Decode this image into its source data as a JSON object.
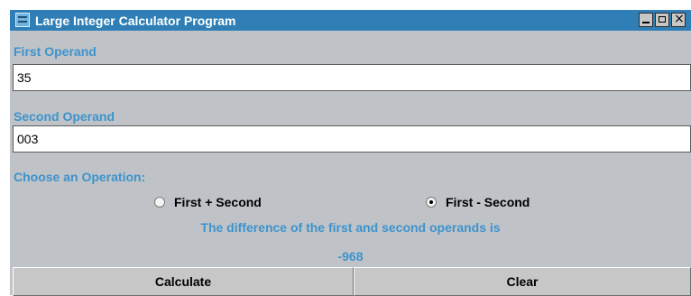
{
  "window": {
    "title": "Large Integer Calculator Program"
  },
  "labels": {
    "first_operand": "First Operand",
    "second_operand": "Second Operand",
    "choose_operation": "Choose an Operation:"
  },
  "inputs": {
    "first_value": "35",
    "second_value": "003"
  },
  "operations": [
    {
      "label": "First + Second",
      "selected": false
    },
    {
      "label": "First - Second",
      "selected": true
    }
  ],
  "result": {
    "message": "The difference of the first and second operands is",
    "value": "-968"
  },
  "buttons": {
    "calculate": "Calculate",
    "clear": "Clear"
  },
  "icons": {
    "app": "app-icon",
    "minimize": "minimize-icon",
    "maximize": "maximize-icon",
    "close": "close-icon"
  }
}
